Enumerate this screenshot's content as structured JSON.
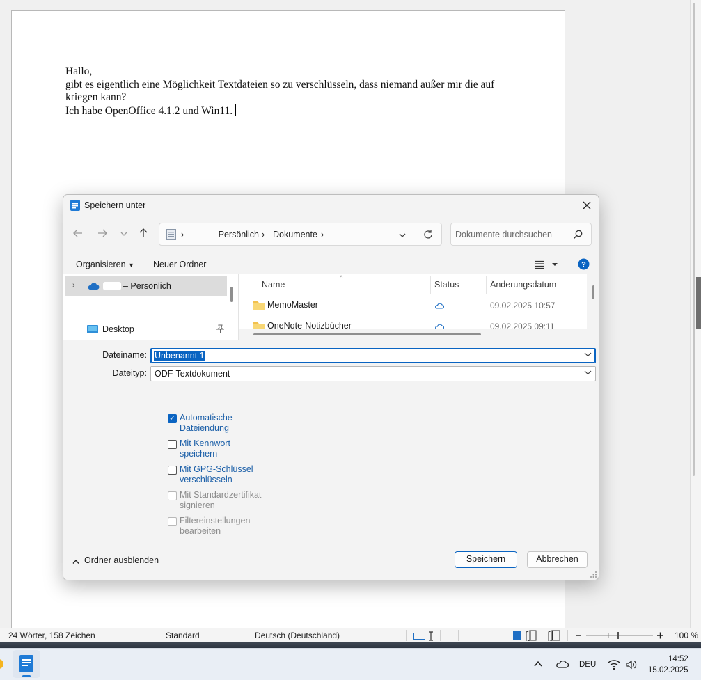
{
  "document": {
    "lines": [
      "Hallo,",
      "gibt es eigentlich eine Möglichkeit Textdateien so zu verschlüsseln, dass niemand außer mir die auf kriegen kann?",
      "Ich habe OpenOffice 4.1.2 und Win11."
    ]
  },
  "statusbar": {
    "word_count": "24 Wörter, 158 Zeichen",
    "page_style": "Standard",
    "language": "Deutsch (Deutschland)",
    "zoom": "100 %"
  },
  "dialog": {
    "title": "Speichern unter",
    "breadcrumb": [
      "- Persönlich",
      "Dokumente"
    ],
    "search_placeholder": "Dokumente durchsuchen",
    "commands": {
      "organize": "Organisieren",
      "new_folder": "Neuer Ordner"
    },
    "nav_pane": {
      "onedrive": "– Persönlich",
      "desktop": "Desktop"
    },
    "columns": {
      "name": "Name",
      "status": "Status",
      "modified": "Änderungsdatum"
    },
    "files": [
      {
        "name": "MemoMaster",
        "date": "09.02.2025 10:57"
      },
      {
        "name": "OneNote-Notizbücher",
        "date": "09.02.2025 09:11"
      }
    ],
    "filename_label": "Dateiname:",
    "filename_value": "Unbenannt 1",
    "filetype_label": "Dateityp:",
    "filetype_value": "ODF-Textdokument",
    "options": [
      {
        "label": "Automatische Dateiendung",
        "checked": true,
        "enabled": true
      },
      {
        "label": "Mit Kennwort speichern",
        "checked": false,
        "enabled": true
      },
      {
        "label": "Mit GPG-Schlüssel verschlüsseln",
        "checked": false,
        "enabled": true
      },
      {
        "label": "Mit Standardzertifikat signieren",
        "checked": false,
        "enabled": false
      },
      {
        "label": "Filtereinstellungen bearbeiten",
        "checked": false,
        "enabled": false
      }
    ],
    "hide_folders": "Ordner ausblenden",
    "save_button": "Speichern",
    "cancel_button": "Abbrechen"
  },
  "taskbar": {
    "language": "DEU",
    "time": "14:52",
    "date": "15.02.2025"
  },
  "colors": {
    "accent": "#0a64c2",
    "link_blue": "#1b5fa8"
  }
}
